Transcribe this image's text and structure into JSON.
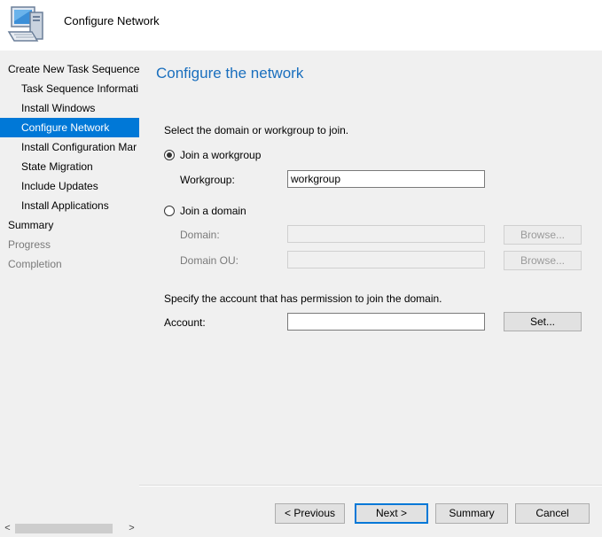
{
  "window": {
    "title": "Configure Network",
    "icon": "computer-icon"
  },
  "sidebar": {
    "items": [
      {
        "label": "Create New Task Sequence",
        "state": "normal",
        "level": 0
      },
      {
        "label": "Task Sequence Informati",
        "state": "normal",
        "level": 1
      },
      {
        "label": "Install Windows",
        "state": "normal",
        "level": 1
      },
      {
        "label": "Configure Network",
        "state": "selected",
        "level": 1
      },
      {
        "label": "Install Configuration Mar",
        "state": "normal",
        "level": 1
      },
      {
        "label": "State Migration",
        "state": "normal",
        "level": 1
      },
      {
        "label": "Include Updates",
        "state": "normal",
        "level": 1
      },
      {
        "label": "Install Applications",
        "state": "normal",
        "level": 1
      },
      {
        "label": "Summary",
        "state": "normal",
        "level": 0
      },
      {
        "label": "Progress",
        "state": "disabled",
        "level": 0
      },
      {
        "label": "Completion",
        "state": "disabled",
        "level": 0
      }
    ],
    "scroll_left": "<",
    "scroll_right": ">"
  },
  "main": {
    "title": "Configure the network",
    "instruction": "Select the domain or workgroup to join.",
    "workgroup_radio": {
      "label": "Join a workgroup",
      "checked": true
    },
    "workgroup_field": {
      "label": "Workgroup:",
      "value": "workgroup"
    },
    "domain_radio": {
      "label": "Join a domain",
      "checked": false
    },
    "domain_field": {
      "label": "Domain:",
      "value": "",
      "browse": "Browse..."
    },
    "domain_ou_field": {
      "label": "Domain OU:",
      "value": "",
      "browse": "Browse..."
    },
    "account_instruction": "Specify the account that has permission to join the domain.",
    "account_field": {
      "label": "Account:",
      "value": "",
      "set": "Set..."
    }
  },
  "footer": {
    "previous": "< Previous",
    "next": "Next >",
    "summary": "Summary",
    "cancel": "Cancel"
  },
  "colors": {
    "accent": "#0078d7",
    "title": "#1a6fbe"
  }
}
